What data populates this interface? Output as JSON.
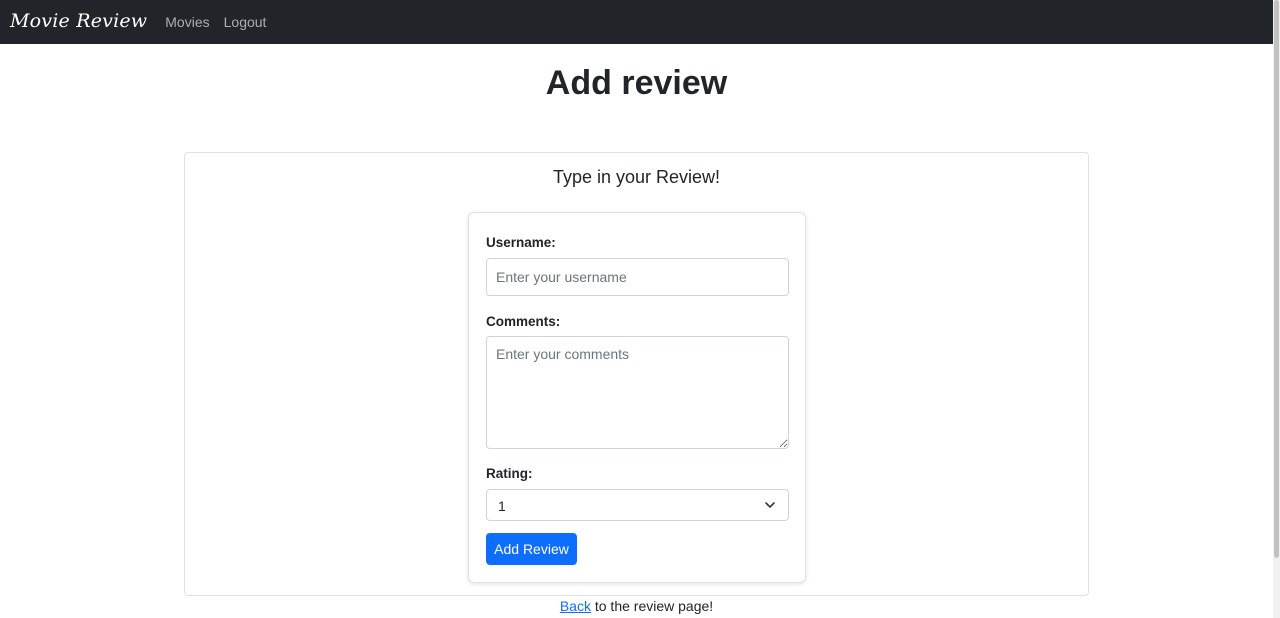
{
  "navbar": {
    "brand": "Movie Review",
    "links": [
      "Movies",
      "Logout"
    ]
  },
  "page": {
    "title": "Add review"
  },
  "card": {
    "heading": "Type in your Review!"
  },
  "form": {
    "username_label": "Username:",
    "username_placeholder": "Enter your username",
    "username_value": "",
    "comments_label": "Comments:",
    "comments_placeholder": "Enter your comments",
    "comments_value": "",
    "rating_label": "Rating:",
    "rating_selected": "1",
    "submit_label": "Add Review"
  },
  "footer": {
    "link_text": "Back",
    "rest_text": " to the review page!"
  },
  "colors": {
    "navbar_bg": "#212529",
    "primary": "#0d6efd"
  },
  "icons": {
    "select_caret": "chevron-down-icon"
  }
}
